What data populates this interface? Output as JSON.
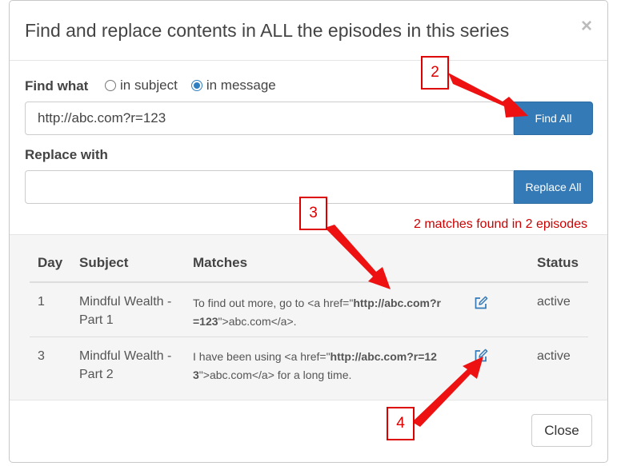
{
  "dialog": {
    "title": "Find and replace contents in ALL the episodes in this series",
    "close_symbol": "×"
  },
  "find": {
    "label": "Find what",
    "radio_subject": "in subject",
    "radio_message": "in message",
    "selected": "in message",
    "value": "http://abc.com?r=123",
    "button": "Find All"
  },
  "replace": {
    "label": "Replace with",
    "value": "",
    "button": "Replace All"
  },
  "summary": "2 matches found in 2 episodes",
  "table": {
    "headers": {
      "day": "Day",
      "subject": "Subject",
      "matches": "Matches",
      "status": "Status"
    },
    "rows": [
      {
        "day": "1",
        "subject_line1": "Mindful Wealth -",
        "subject_line2": "Part 1",
        "match_pre": "To find out more, go to <a href=\"",
        "match_bold1": "http://abc.com?r",
        "match_bold2": "=123",
        "match_post": "\">abc.com</a>.",
        "status": "active"
      },
      {
        "day": "3",
        "subject_line1": "Mindful Wealth -",
        "subject_line2": "Part 2",
        "match_pre": "I have been using <a href=\"",
        "match_bold1": "http://abc.com?r=12",
        "match_bold2": "3",
        "match_post": "\">abc.com</a> for a long time.",
        "status": "active"
      }
    ]
  },
  "footer": {
    "close_button": "Close"
  },
  "callouts": {
    "c2": "2",
    "c3": "3",
    "c4": "4"
  },
  "colors": {
    "primary": "#337ab7",
    "annotation": "#dd0000",
    "match_text": "#cc0000"
  }
}
